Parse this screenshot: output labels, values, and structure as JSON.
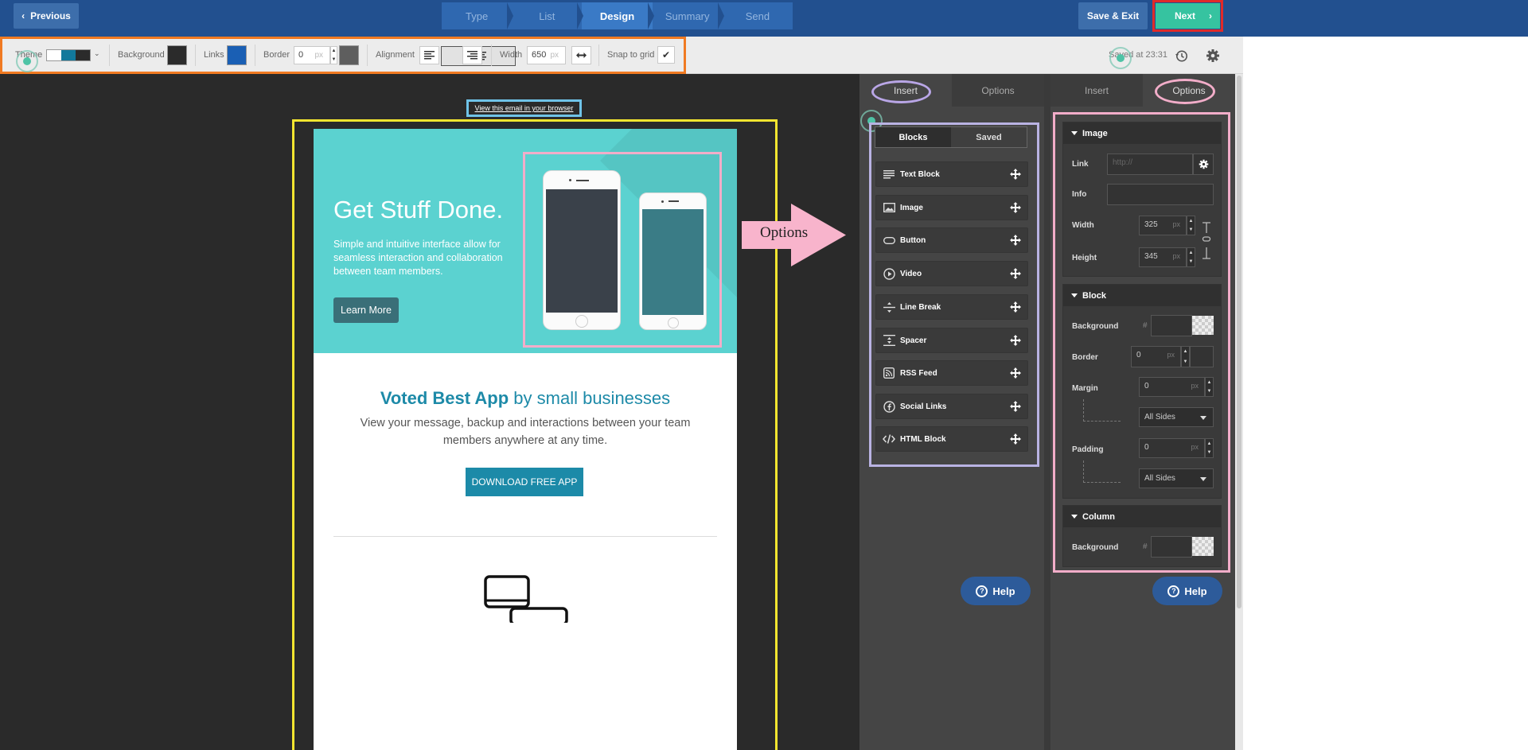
{
  "topbar": {
    "previous_label": "Previous",
    "steps": [
      {
        "label": "Type",
        "active": false
      },
      {
        "label": "List",
        "active": false
      },
      {
        "label": "Design",
        "active": true
      },
      {
        "label": "Summary",
        "active": false
      },
      {
        "label": "Send",
        "active": false
      }
    ],
    "save_exit_label": "Save & Exit",
    "next_label": "Next"
  },
  "toolbar": {
    "theme_label": "Theme",
    "theme_colors": [
      "#ffffff",
      "#12799c",
      "#2b2b2b"
    ],
    "background_label": "Background",
    "background_color": "#2b2b2b",
    "links_label": "Links",
    "links_color": "#1a5fb4",
    "border_label": "Border",
    "border_value": "0",
    "border_unit": "px",
    "border_color": "#5e5e5e",
    "alignment_label": "Alignment",
    "width_label": "Width",
    "width_value": "650",
    "width_unit": "px",
    "snap_label": "Snap to grid",
    "snap_checked": true,
    "saved_text": "Saved at 23:31"
  },
  "canvas": {
    "browser_link": "View this email in your browser",
    "hero": {
      "title": "Get Stuff Done.",
      "text": "Simple and intuitive interface allow for seamless interaction and collaboration between team members.",
      "button": "Learn More"
    },
    "voted_strong": "Voted Best App",
    "voted_rest": " by small businesses",
    "subtitle": "View your message, backup and interactions between your team members anywhere at any time.",
    "download_button": "DOWNLOAD FREE APP"
  },
  "callout": {
    "label": "Options"
  },
  "insert_panel": {
    "tabs": [
      "Insert",
      "Options"
    ],
    "segments": [
      "Blocks",
      "Saved"
    ],
    "blocks": [
      "Text Block",
      "Image",
      "Button",
      "Video",
      "Line Break",
      "Spacer",
      "RSS Feed",
      "Social Links",
      "HTML Block"
    ],
    "help_label": "Help"
  },
  "options_panel": {
    "tabs": [
      "Insert",
      "Options"
    ],
    "image_section": {
      "title": "Image",
      "link_label": "Link",
      "link_placeholder": "http://",
      "info_label": "Info",
      "width_label": "Width",
      "width_value": "325",
      "height_label": "Height",
      "height_value": "345",
      "unit": "px"
    },
    "block_section": {
      "title": "Block",
      "background_label": "Background",
      "border_label": "Border",
      "border_value": "0",
      "margin_label": "Margin",
      "margin_value": "0",
      "margin_sides": "All Sides",
      "padding_label": "Padding",
      "padding_value": "0",
      "padding_sides": "All Sides",
      "unit": "px",
      "hash": "#"
    },
    "column_section": {
      "title": "Column",
      "background_label": "Background",
      "hash": "#"
    },
    "help_label": "Help"
  }
}
